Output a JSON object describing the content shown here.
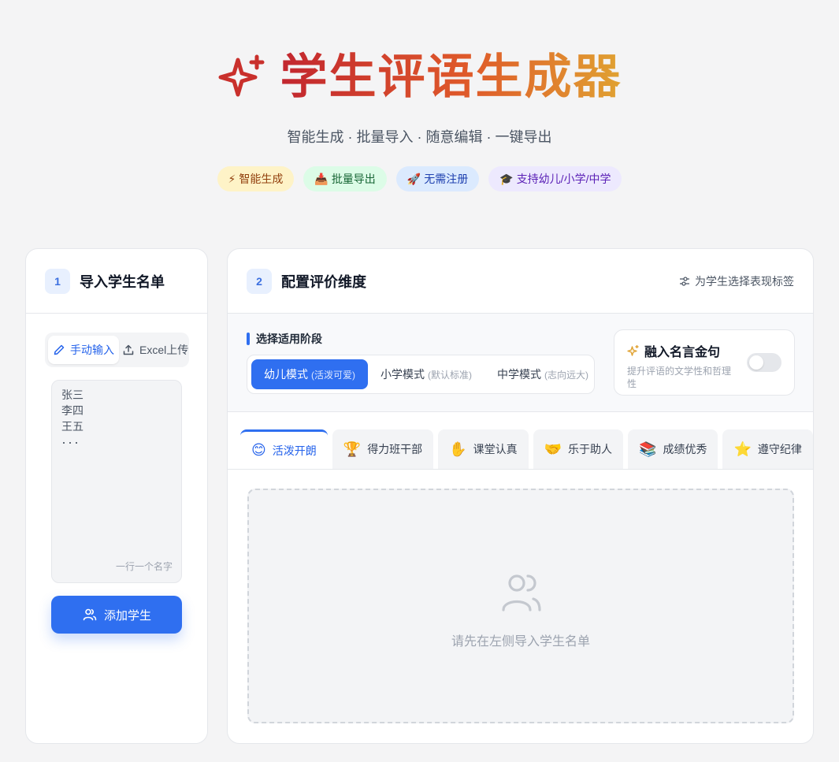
{
  "header": {
    "title": "学生评语生成器",
    "icon": "sparkle-icon",
    "subtitle": "智能生成 · 批量导入 · 随意编辑 · 一键导出",
    "chips": [
      {
        "icon": "⚡",
        "label": "智能生成"
      },
      {
        "icon": "📥",
        "label": "批量导出"
      },
      {
        "icon": "🚀",
        "label": "无需注册"
      },
      {
        "icon": "🎓",
        "label": "支持幼儿/小学/中学"
      }
    ]
  },
  "import_panel": {
    "step": "1",
    "title": "导入学生名单",
    "mode_manual": "手动输入",
    "mode_excel": "Excel上传",
    "names": [
      "张三",
      "李四",
      "王五",
      "···"
    ],
    "names_hint": "一行一个名字",
    "add_button": "添加学生"
  },
  "config_panel": {
    "step": "2",
    "title": "配置评价维度",
    "hint": "为学生选择表现标签",
    "stage_label": "选择适用阶段",
    "stages": [
      {
        "label": "幼儿模式",
        "sub": "(活泼可爱)",
        "active": true
      },
      {
        "label": "小学模式",
        "sub": "(默认标准)",
        "active": false
      },
      {
        "label": "中学模式",
        "sub": "(志向远大)",
        "active": false
      }
    ],
    "quote_title": "融入名言金句",
    "quote_desc": "提升评语的文学性和哲理性",
    "quote_enabled": false,
    "tabs": [
      {
        "emoji": "😊",
        "label": "活泼开朗",
        "active": true
      },
      {
        "emoji": "🏆",
        "label": "得力班干部",
        "active": false
      },
      {
        "emoji": "✋",
        "label": "课堂认真",
        "active": false
      },
      {
        "emoji": "🤝",
        "label": "乐于助人",
        "active": false
      },
      {
        "emoji": "📚",
        "label": "成绩优秀",
        "active": false
      },
      {
        "emoji": "⭐",
        "label": "遵守纪律",
        "active": false
      }
    ],
    "empty_text": "请先在左侧导入学生名单"
  },
  "colors": {
    "accent": "#2f6ff0",
    "title_gradient_start": "#c2262f",
    "title_gradient_end": "#e0a232"
  }
}
